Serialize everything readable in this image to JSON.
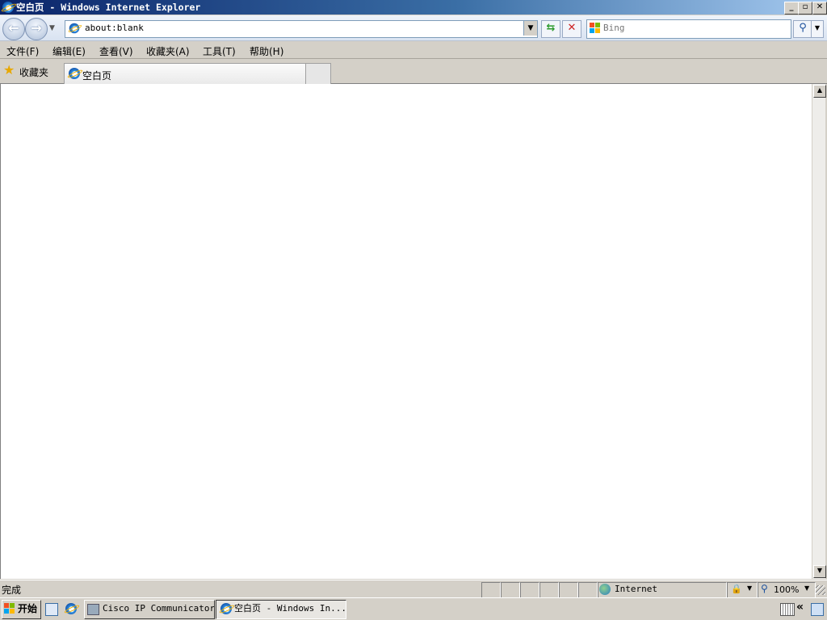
{
  "window": {
    "title": "空白页 - Windows Internet Explorer",
    "caption_buttons": {
      "minimize": "_",
      "maximize": "▫",
      "close": "✕"
    }
  },
  "nav": {
    "address_value": "about:blank",
    "search_placeholder": "Bing",
    "back_icon": "back-arrow-icon",
    "forward_icon": "forward-arrow-icon"
  },
  "menu": {
    "items": [
      "文件(F)",
      "编辑(E)",
      "查看(V)",
      "收藏夹(A)",
      "工具(T)",
      "帮助(H)"
    ]
  },
  "favorites": {
    "label": "收藏夹",
    "tab_title": "空白页"
  },
  "status": {
    "text": "完成",
    "zone": "Internet",
    "zoom": "100%"
  },
  "taskbar": {
    "start_label": "开始",
    "buttons": [
      "Cisco IP Communicator",
      "空白页 - Windows In..."
    ]
  },
  "colors": {
    "titlebar_start": "#0a246a",
    "titlebar_end": "#a6caf0",
    "chrome": "#d4d0c8"
  }
}
